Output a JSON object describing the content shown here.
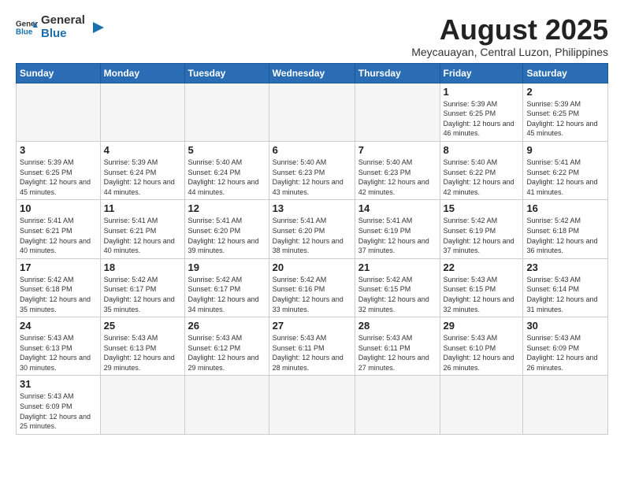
{
  "logo": {
    "text_general": "General",
    "text_blue": "Blue"
  },
  "title": {
    "month_year": "August 2025",
    "location": "Meycauayan, Central Luzon, Philippines"
  },
  "weekdays": [
    "Sunday",
    "Monday",
    "Tuesday",
    "Wednesday",
    "Thursday",
    "Friday",
    "Saturday"
  ],
  "weeks": [
    [
      {
        "day": "",
        "info": ""
      },
      {
        "day": "",
        "info": ""
      },
      {
        "day": "",
        "info": ""
      },
      {
        "day": "",
        "info": ""
      },
      {
        "day": "",
        "info": ""
      },
      {
        "day": "1",
        "info": "Sunrise: 5:39 AM\nSunset: 6:25 PM\nDaylight: 12 hours and 46 minutes."
      },
      {
        "day": "2",
        "info": "Sunrise: 5:39 AM\nSunset: 6:25 PM\nDaylight: 12 hours and 45 minutes."
      }
    ],
    [
      {
        "day": "3",
        "info": "Sunrise: 5:39 AM\nSunset: 6:25 PM\nDaylight: 12 hours and 45 minutes."
      },
      {
        "day": "4",
        "info": "Sunrise: 5:39 AM\nSunset: 6:24 PM\nDaylight: 12 hours and 44 minutes."
      },
      {
        "day": "5",
        "info": "Sunrise: 5:40 AM\nSunset: 6:24 PM\nDaylight: 12 hours and 44 minutes."
      },
      {
        "day": "6",
        "info": "Sunrise: 5:40 AM\nSunset: 6:23 PM\nDaylight: 12 hours and 43 minutes."
      },
      {
        "day": "7",
        "info": "Sunrise: 5:40 AM\nSunset: 6:23 PM\nDaylight: 12 hours and 42 minutes."
      },
      {
        "day": "8",
        "info": "Sunrise: 5:40 AM\nSunset: 6:22 PM\nDaylight: 12 hours and 42 minutes."
      },
      {
        "day": "9",
        "info": "Sunrise: 5:41 AM\nSunset: 6:22 PM\nDaylight: 12 hours and 41 minutes."
      }
    ],
    [
      {
        "day": "10",
        "info": "Sunrise: 5:41 AM\nSunset: 6:21 PM\nDaylight: 12 hours and 40 minutes."
      },
      {
        "day": "11",
        "info": "Sunrise: 5:41 AM\nSunset: 6:21 PM\nDaylight: 12 hours and 40 minutes."
      },
      {
        "day": "12",
        "info": "Sunrise: 5:41 AM\nSunset: 6:20 PM\nDaylight: 12 hours and 39 minutes."
      },
      {
        "day": "13",
        "info": "Sunrise: 5:41 AM\nSunset: 6:20 PM\nDaylight: 12 hours and 38 minutes."
      },
      {
        "day": "14",
        "info": "Sunrise: 5:41 AM\nSunset: 6:19 PM\nDaylight: 12 hours and 37 minutes."
      },
      {
        "day": "15",
        "info": "Sunrise: 5:42 AM\nSunset: 6:19 PM\nDaylight: 12 hours and 37 minutes."
      },
      {
        "day": "16",
        "info": "Sunrise: 5:42 AM\nSunset: 6:18 PM\nDaylight: 12 hours and 36 minutes."
      }
    ],
    [
      {
        "day": "17",
        "info": "Sunrise: 5:42 AM\nSunset: 6:18 PM\nDaylight: 12 hours and 35 minutes."
      },
      {
        "day": "18",
        "info": "Sunrise: 5:42 AM\nSunset: 6:17 PM\nDaylight: 12 hours and 35 minutes."
      },
      {
        "day": "19",
        "info": "Sunrise: 5:42 AM\nSunset: 6:17 PM\nDaylight: 12 hours and 34 minutes."
      },
      {
        "day": "20",
        "info": "Sunrise: 5:42 AM\nSunset: 6:16 PM\nDaylight: 12 hours and 33 minutes."
      },
      {
        "day": "21",
        "info": "Sunrise: 5:42 AM\nSunset: 6:15 PM\nDaylight: 12 hours and 32 minutes."
      },
      {
        "day": "22",
        "info": "Sunrise: 5:43 AM\nSunset: 6:15 PM\nDaylight: 12 hours and 32 minutes."
      },
      {
        "day": "23",
        "info": "Sunrise: 5:43 AM\nSunset: 6:14 PM\nDaylight: 12 hours and 31 minutes."
      }
    ],
    [
      {
        "day": "24",
        "info": "Sunrise: 5:43 AM\nSunset: 6:13 PM\nDaylight: 12 hours and 30 minutes."
      },
      {
        "day": "25",
        "info": "Sunrise: 5:43 AM\nSunset: 6:13 PM\nDaylight: 12 hours and 29 minutes."
      },
      {
        "day": "26",
        "info": "Sunrise: 5:43 AM\nSunset: 6:12 PM\nDaylight: 12 hours and 29 minutes."
      },
      {
        "day": "27",
        "info": "Sunrise: 5:43 AM\nSunset: 6:11 PM\nDaylight: 12 hours and 28 minutes."
      },
      {
        "day": "28",
        "info": "Sunrise: 5:43 AM\nSunset: 6:11 PM\nDaylight: 12 hours and 27 minutes."
      },
      {
        "day": "29",
        "info": "Sunrise: 5:43 AM\nSunset: 6:10 PM\nDaylight: 12 hours and 26 minutes."
      },
      {
        "day": "30",
        "info": "Sunrise: 5:43 AM\nSunset: 6:09 PM\nDaylight: 12 hours and 26 minutes."
      }
    ],
    [
      {
        "day": "31",
        "info": "Sunrise: 5:43 AM\nSunset: 6:09 PM\nDaylight: 12 hours and 25 minutes."
      },
      {
        "day": "",
        "info": ""
      },
      {
        "day": "",
        "info": ""
      },
      {
        "day": "",
        "info": ""
      },
      {
        "day": "",
        "info": ""
      },
      {
        "day": "",
        "info": ""
      },
      {
        "day": "",
        "info": ""
      }
    ]
  ]
}
